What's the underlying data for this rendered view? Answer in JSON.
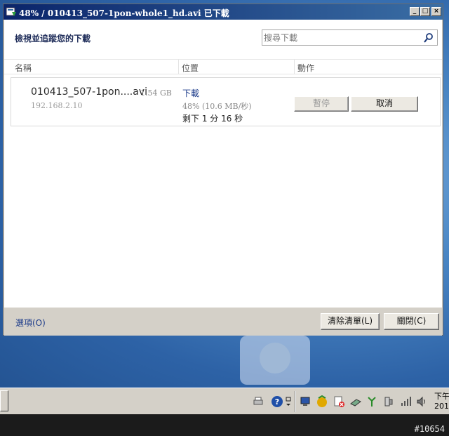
{
  "window": {
    "title": "48% / 010413_507-1pon-whole1_hd.avi 已下載",
    "minimize": "_",
    "maximize": "□",
    "close": "×"
  },
  "header": {
    "heading": "檢視並追蹤您的下載",
    "search_placeholder": "搜尋下載"
  },
  "columns": {
    "name": "名稱",
    "location": "位置",
    "action": "動作"
  },
  "download": {
    "filename": "010413_507-1pon....avi",
    "size": "1.54 GB",
    "source": "192.168.2.10",
    "status": "下載",
    "progress_text": "48% (10.6 MB/秒)",
    "remaining": "剩下 1 分 16 秒",
    "progress_percent": 48,
    "pause_label": "暫停",
    "cancel_label": "取消"
  },
  "footer": {
    "options_label": "選項(O)",
    "clear_list_label": "清除清單(L)",
    "close_label": "關閉(C)"
  },
  "taskbar": {
    "clock_line1": "下午",
    "clock_line2": "201"
  },
  "watermark": "#10654",
  "colors": {
    "title_dark": "#0a246a",
    "title_light": "#3a6ea5",
    "link": "#1c3b8a",
    "desktop": "#4a86c4"
  }
}
